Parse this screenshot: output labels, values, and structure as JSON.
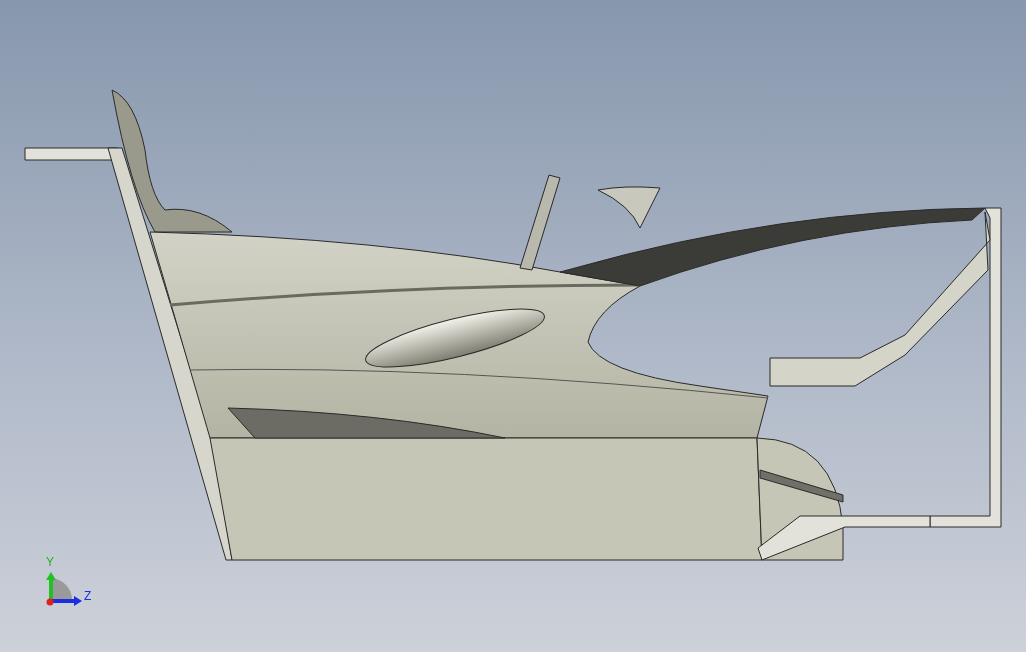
{
  "triad": {
    "labels": [
      {
        "kind": "vertical",
        "text": "Y"
      },
      {
        "kind": "horizontal",
        "text": "Z"
      }
    ]
  }
}
